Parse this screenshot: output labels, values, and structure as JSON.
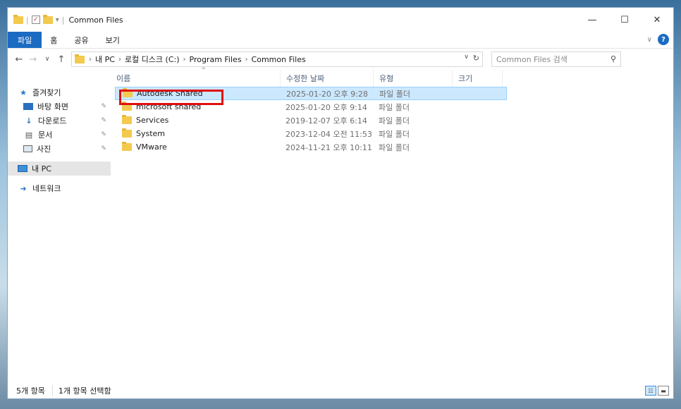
{
  "window": {
    "title": "Common Files",
    "controls": {
      "minimize": "—",
      "maximize": "☐",
      "close": "✕"
    }
  },
  "ribbon": {
    "tabs": [
      "파일",
      "홈",
      "공유",
      "보기"
    ],
    "help": "?"
  },
  "address": {
    "breadcrumbs": [
      "내 PC",
      "로컬 디스크 (C:)",
      "Program Files",
      "Common Files"
    ],
    "search_placeholder": "Common Files 검색"
  },
  "nav": {
    "quick_access": "즐겨찾기",
    "items": [
      "바탕 화면",
      "다운로드",
      "문서",
      "사진"
    ],
    "this_pc": "내 PC",
    "network": "네트워크"
  },
  "columns": {
    "name": "이름",
    "date": "수정한 날짜",
    "type": "유형",
    "size": "크기"
  },
  "files": [
    {
      "name": "Autodesk Shared",
      "date": "2025-01-20 오후 9:28",
      "type": "파일 폴더",
      "size": ""
    },
    {
      "name": "microsoft shared",
      "date": "2025-01-20 오후 9:14",
      "type": "파일 폴더",
      "size": ""
    },
    {
      "name": "Services",
      "date": "2019-12-07 오후 6:14",
      "type": "파일 폴더",
      "size": ""
    },
    {
      "name": "System",
      "date": "2023-12-04 오전 11:53",
      "type": "파일 폴더",
      "size": ""
    },
    {
      "name": "VMware",
      "date": "2024-11-21 오후 10:11",
      "type": "파일 폴더",
      "size": ""
    }
  ],
  "status": {
    "count": "5개 항목",
    "selected": "1개 항목 선택함"
  },
  "colors": {
    "accent": "#1c6bc2",
    "selection": "#cce8ff",
    "highlight_box": "#e01010",
    "folder": "#f3c94e"
  }
}
